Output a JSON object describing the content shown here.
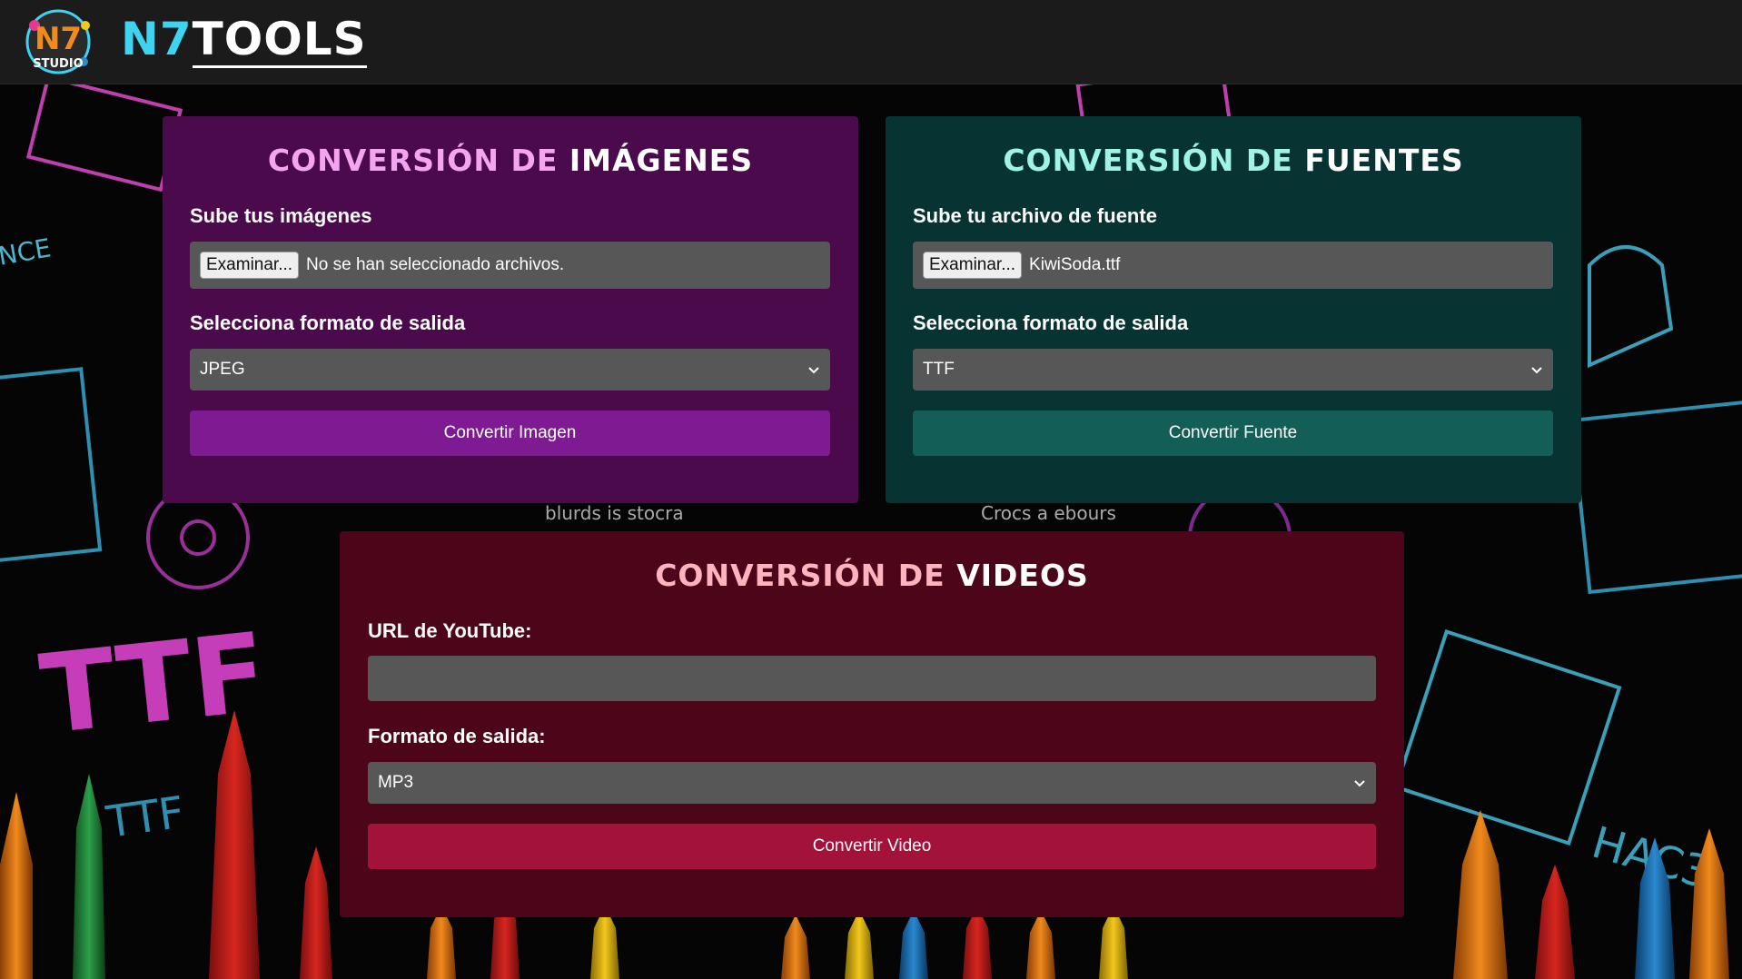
{
  "header": {
    "logo_badge_text": "N7",
    "logo_badge_subtext": "STUDIO",
    "brand_part1": "N7",
    "brand_part2": "TOOLS"
  },
  "image_card": {
    "title_part1": "Conversión de ",
    "title_part2": "Imágenes",
    "upload_label": "Sube tus imágenes",
    "browse_button": "Examinar...",
    "file_status": "No se han seleccionado archivos.",
    "format_label": "Selecciona formato de salida",
    "format_value": "JPEG",
    "convert_button": "Convertir Imagen"
  },
  "font_card": {
    "title_part1": "Conversión de ",
    "title_part2": "Fuentes",
    "upload_label": "Sube tu archivo de fuente",
    "browse_button": "Examinar...",
    "file_status": "KiwiSoda.ttf",
    "format_label": "Selecciona formato de salida",
    "format_value": "TTF",
    "convert_button": "Convertir Fuente"
  },
  "video_card": {
    "title_part1": "Conversión de ",
    "title_part2": "Videos",
    "url_label": "URL de YouTube:",
    "url_value": "",
    "format_label": "Formato de salida:",
    "format_value": "MP3",
    "convert_button": "Convertir Video"
  },
  "colors": {
    "header_bg": "#1b1b1b",
    "image_card_bg": "#4a0a4c",
    "font_card_bg": "#073433",
    "video_card_bg": "#4d0519",
    "image_button": "#7f1b92",
    "font_button": "#145e58",
    "video_button": "#a31239",
    "input_bg": "#575757",
    "brand_accent": "#3fd3f2"
  }
}
